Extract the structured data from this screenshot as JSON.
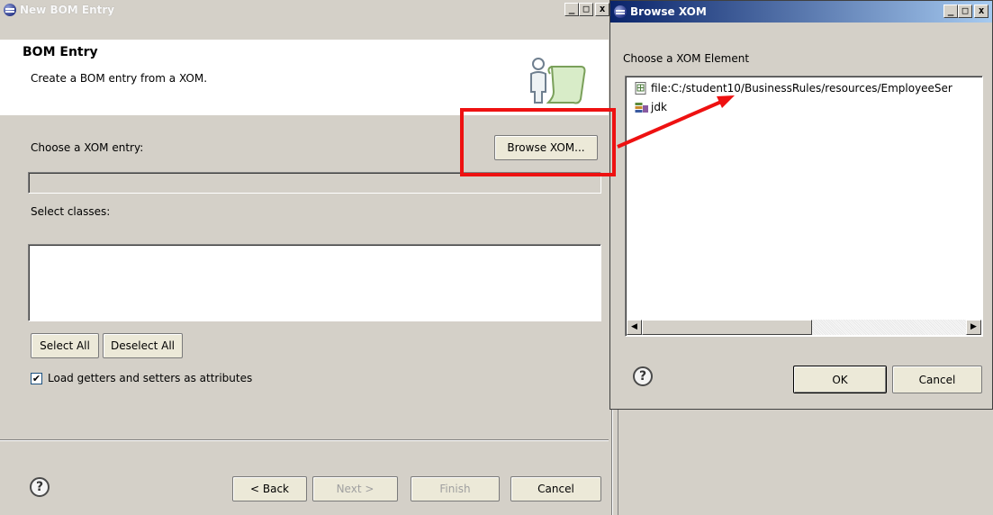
{
  "bom_dialog": {
    "title": "New BOM Entry",
    "banner_title": "BOM Entry",
    "banner_description": "Create a BOM entry from a XOM.",
    "xom_entry_label": "Choose a XOM entry:",
    "browse_button": "Browse XOM...",
    "xom_entry_value": "",
    "select_classes_label": "Select classes:",
    "select_all_button": "Select All",
    "deselect_all_button": "Deselect All",
    "load_getters_checkbox": {
      "label": "Load getters and setters as attributes",
      "checked": true
    },
    "help_glyph": "?",
    "back_button": "< Back",
    "next_button": "Next >",
    "finish_button": "Finish",
    "cancel_button": "Cancel"
  },
  "xom_dialog": {
    "title": "Browse XOM",
    "prompt": "Choose a XOM Element",
    "tree_items": [
      {
        "label": "file:C:/student10/BusinessRules/resources/EmployeeSer",
        "icon": "xom-file-icon"
      },
      {
        "label": "jdk",
        "icon": "jdk-library-icon"
      }
    ],
    "help_glyph": "?",
    "ok_button": "OK",
    "cancel_button": "Cancel"
  },
  "caption_buttons": {
    "minimize": "_",
    "maximize": "□",
    "close": "x"
  },
  "colors": {
    "dialog_bg": "#d4d0c8",
    "active_title_start": "#0a246a",
    "active_title_end": "#a6caf0",
    "annotation_red": "#ee1111"
  }
}
